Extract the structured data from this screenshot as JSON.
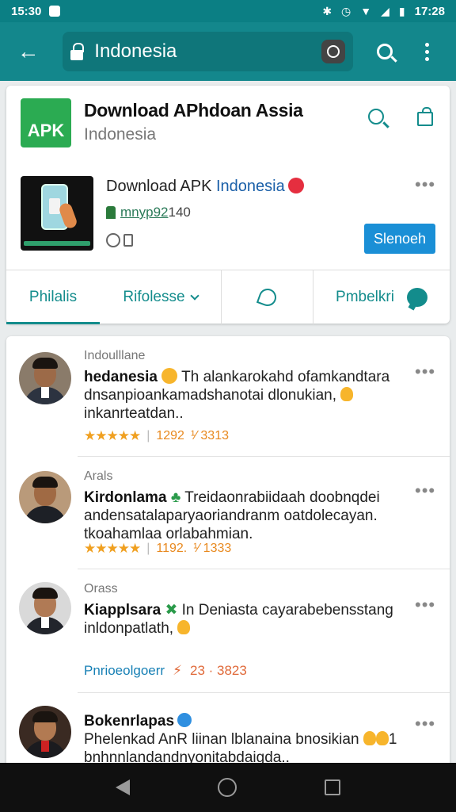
{
  "status_bar": {
    "time": "15:30",
    "right_time": "17:28",
    "icons": [
      "notification-icon",
      "bluetooth-icon",
      "alarm-icon",
      "wifi-icon",
      "signal-icon",
      "battery-icon"
    ]
  },
  "app_bar": {
    "url_text": "Indonesia",
    "icons": [
      "back-arrow-icon",
      "lock-icon",
      "reload-icon",
      "search-icon",
      "more-vert-icon"
    ]
  },
  "site": {
    "logo_text": "APK",
    "title": "Download APhdoan Assia",
    "subtitle": "Indonesia"
  },
  "app": {
    "name_prefix": "Download APK ",
    "name_highlight": "Indonesia",
    "meta_link": "mnyp92",
    "meta_rest": "140",
    "select_label": "Slenoeh"
  },
  "tabs": [
    {
      "label": "Philalis"
    },
    {
      "label": "Rifolesse"
    },
    {
      "label": ""
    },
    {
      "label": "Pmbelkri"
    }
  ],
  "posts": [
    {
      "user": "Indoulllane",
      "name": "hedanesia",
      "text_1": " Th alankarokahd ofamkandtara dnsanpioankamadshanotai dlonukian, ",
      "text_2": "inkanrteatdan..",
      "stars": "★★★★★",
      "count_a": "1292",
      "count_b": "¹⁄ 3313"
    },
    {
      "user": "Arals",
      "name": "Kirdonlama",
      "text_1": " Treidaonrabiidaah doobnqdei andensatalaparyaoriandranm oatdolecayan.",
      "text_2": "tkoahamlaa orlabahmian.",
      "stars": "★★★★★",
      "count_a": "1192.",
      "count_b": "¹⁄ 1333"
    },
    {
      "user": "Orass",
      "name": "Kiapplsara",
      "text_1": " In Deniasta cayarabebensstang",
      "text_2": "inldonpatlath, ",
      "link_label": "Pnrioeolgoerr",
      "link_score": "23 · 3823"
    },
    {
      "user": "",
      "name": "Bokenrlapas",
      "text_1": "Phelenkad AnR liinan lblanaina bnosikian ",
      "text_tail": "1",
      "text_2": "bnhnnlandandnyonitabdaigda.."
    }
  ],
  "nav": {
    "icons": [
      "nav-back-icon",
      "nav-home-icon",
      "nav-recents-icon"
    ]
  },
  "colors": {
    "teal": "#13878c",
    "teal_dark": "#0f767a",
    "accent_blue": "#1a8fd6",
    "star": "#f0a020",
    "apk_green": "#2bab52"
  }
}
